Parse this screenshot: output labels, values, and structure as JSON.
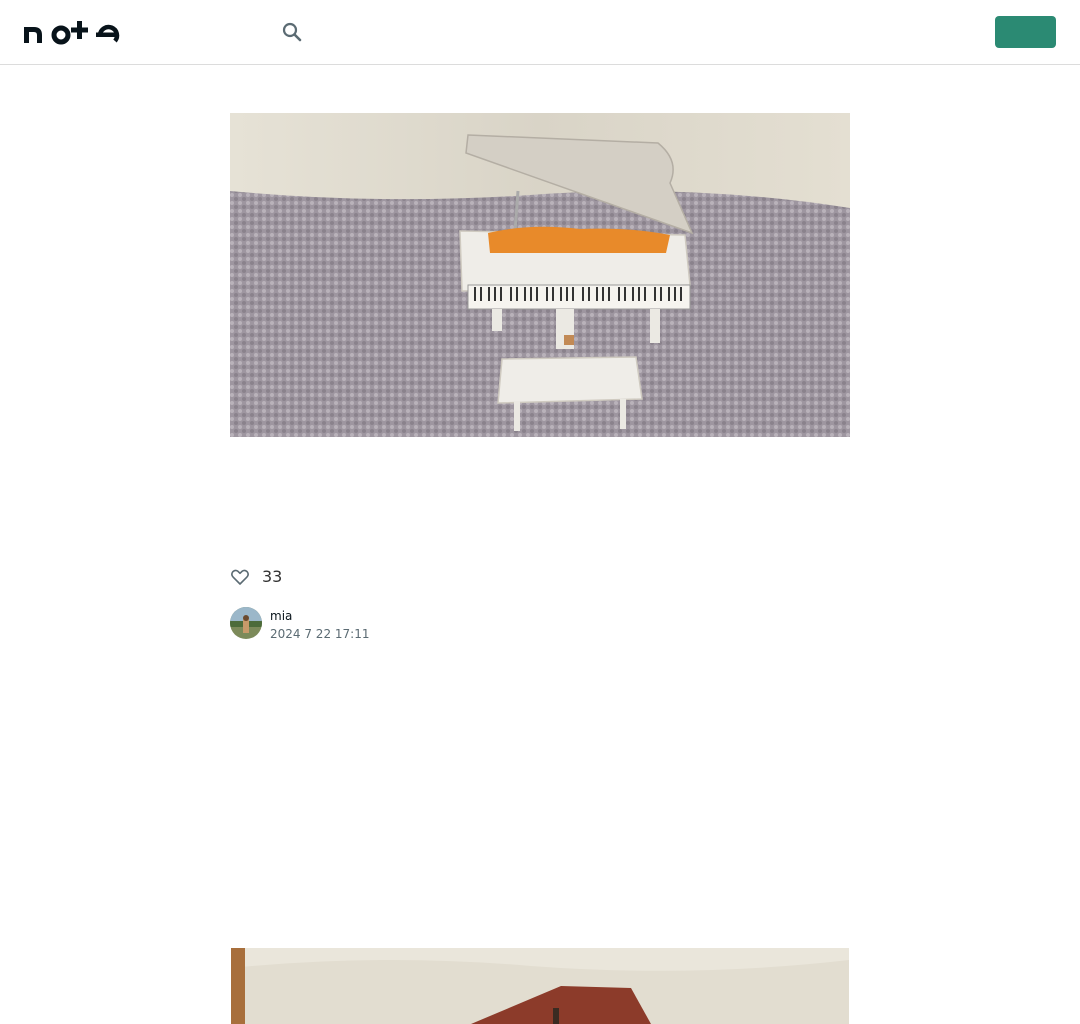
{
  "header": {
    "logo_text": "note",
    "search_icon": "search-icon",
    "login_label": "",
    "signup_label": "",
    "brand_color": "#2b8a73"
  },
  "hero": {
    "image": "grand-piano-model-on-carpet"
  },
  "article": {
    "title": "",
    "likes": "33",
    "author": "mia",
    "date": "2024 7 22 17:11",
    "paragraphs": [
      "",
      "",
      ""
    ]
  },
  "second_image": {
    "image": "house-model-roof"
  }
}
